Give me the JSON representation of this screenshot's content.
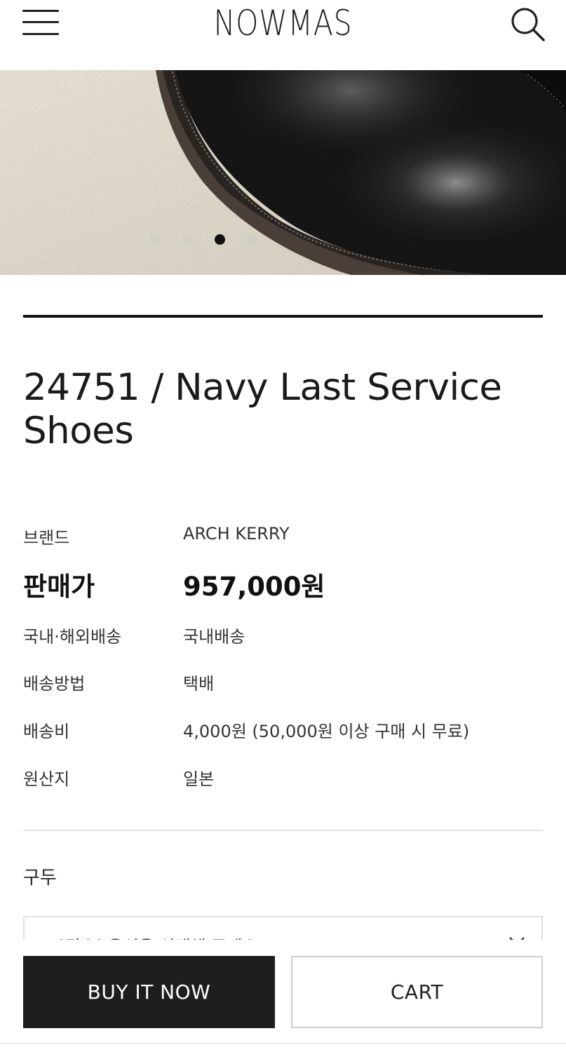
{
  "header": {
    "logo": "NOWMAS",
    "menu_icon": "hamburger-menu-icon",
    "search_icon": "search-icon"
  },
  "gallery": {
    "image_alt": "black leather shoe toe on concrete",
    "current_slide": 3,
    "total_dots": 4
  },
  "product": {
    "title_line1": "24751 / Navy Last Service",
    "title_line2": "Shoes"
  },
  "info": {
    "brand": {
      "label": "브랜드",
      "value": "ARCH KERRY"
    },
    "price": {
      "label": "판매가",
      "value": "957,000원"
    },
    "shipping_type": {
      "label": "국내·해외배송",
      "value": "국내배송"
    },
    "shipping_method": {
      "label": "배송방법",
      "value": "택배"
    },
    "shipping_fee": {
      "label": "배송비",
      "value": "4,000원 (50,000원 이상 구매 시 무료)"
    },
    "origin": {
      "label": "원산지",
      "value": "일본"
    }
  },
  "options": {
    "title": "구두",
    "select_placeholder": "[필수] 옵션을 선택해 주세요"
  },
  "actions": {
    "buy_now": "BUY IT NOW",
    "cart": "CART"
  },
  "colors": {
    "primary_button": "#1e1e1e",
    "active_dot": "#111111",
    "inactive_dot": "#cccccc"
  }
}
